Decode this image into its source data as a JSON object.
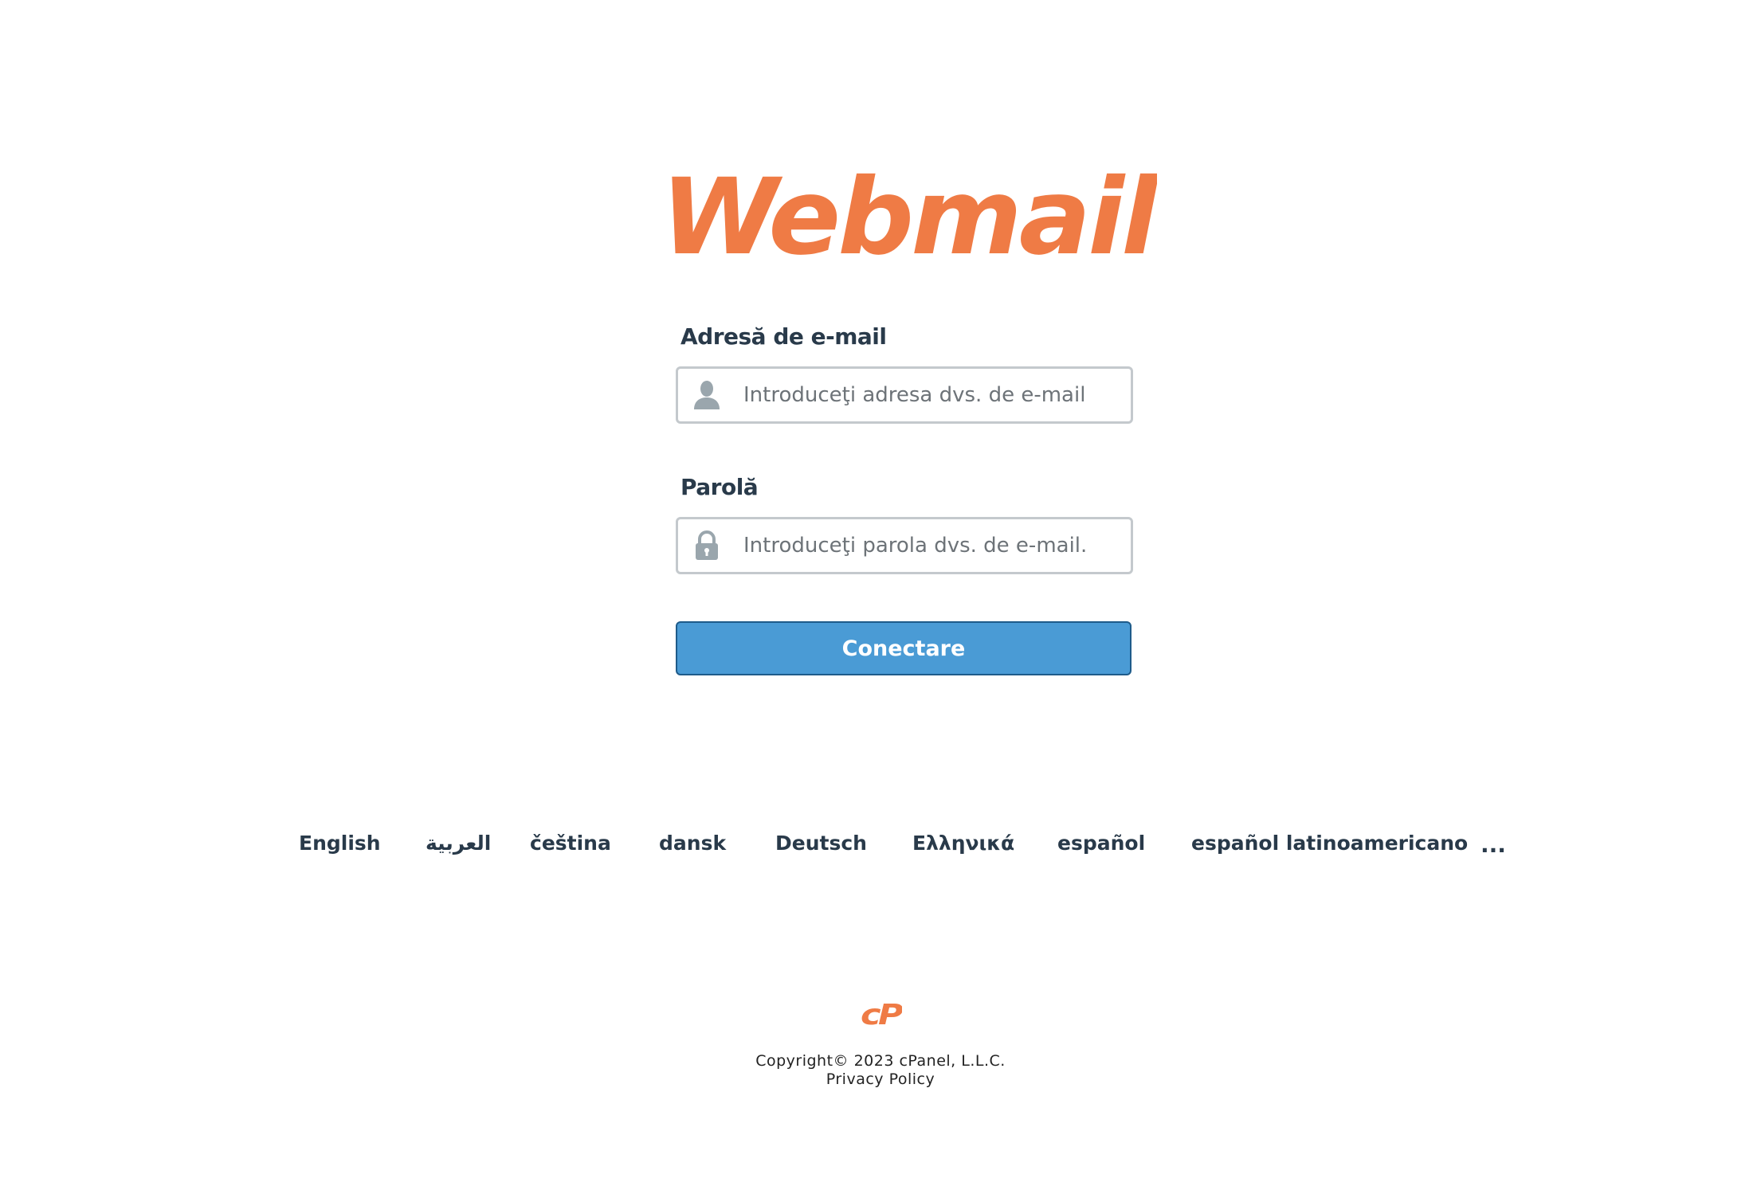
{
  "brand": {
    "logo_text": "Webmail",
    "accent_color": "#ef7b45"
  },
  "login_form": {
    "email_label": "Adresă de e-mail",
    "email_placeholder": "Introduceţi adresa dvs. de e-mail",
    "email_icon": "user-icon",
    "password_label": "Parolă",
    "password_placeholder": "Introduceţi parola dvs. de e-mail.",
    "password_icon": "lock-icon",
    "submit_label": "Conectare",
    "submit_color": "#4a9bd5"
  },
  "languages": {
    "items": [
      "English",
      "العربية",
      "čeština",
      "dansk",
      "Deutsch",
      "Ελληνικά",
      "español",
      "español latinoamericano"
    ],
    "more_label": "..."
  },
  "footer": {
    "cpanel_logo_text": "cP",
    "copyright": "Copyright© 2023 cPanel, L.L.C.",
    "privacy_link": "Privacy Policy"
  }
}
